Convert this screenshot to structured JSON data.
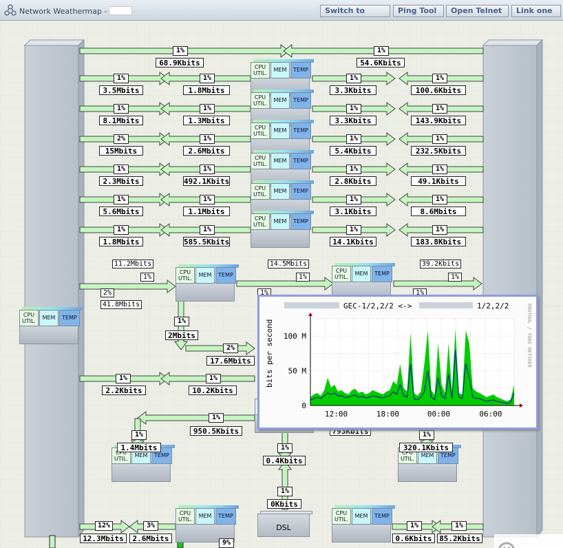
{
  "window": {
    "title": "Network Weathermap -",
    "buttons": [
      {
        "label": "Switch to",
        "x": 465,
        "w": 102
      },
      {
        "label": "Ping Tool",
        "x": 571,
        "w": 74
      },
      {
        "label": "Open Telnet",
        "x": 648,
        "w": 91
      },
      {
        "label": "Link one",
        "x": 743,
        "w": 72
      }
    ]
  },
  "device_labels": {
    "cpu": "CPU UTIL.",
    "cpu_short": "CPU",
    "mem": "MEM",
    "temp": "TEMP"
  },
  "dsl_label": "DSL",
  "link_rows": [
    {
      "lp": "1%",
      "lv": "68.9Kbits",
      "rp": "1%",
      "rv": "54.6Kbits"
    },
    {
      "p1": "1%",
      "v1": "3.5Mbits",
      "p2": "1%",
      "v2": "1.8Mbits",
      "p3": "1%",
      "v3": "3.3Kbits",
      "p4": "1%",
      "v4": "100.6Kbits"
    },
    {
      "p1": "1%",
      "v1": "8.1Mbits",
      "p2": "1%",
      "v2": "1.3Mbits",
      "p3": "1%",
      "v3": "3.3Kbits",
      "p4": "1%",
      "v4": "143.9Kbits"
    },
    {
      "p1": "2%",
      "v1": "15Mbits",
      "p2": "1%",
      "v2": "2.6Mbits",
      "p3": "1%",
      "v3": "5.4Kbits",
      "p4": "1%",
      "v4": "232.5Kbits"
    },
    {
      "p1": "1%",
      "v1": "2.3Mbits",
      "p2": "1%",
      "v2": "492.1Kbits",
      "p3": "1%",
      "v3": "2.8Kbits",
      "p4": "1%",
      "v4": "49.1Kbits"
    },
    {
      "p1": "1%",
      "v1": "5.6Mbits",
      "p2": "1%",
      "v2": "1.1Mbits",
      "p3": "1%",
      "v3": "3.1Kbits",
      "p4": "1%",
      "v4": "8.6Mbits"
    },
    {
      "p1": "1%",
      "v1": "1.8Mbits",
      "p2": "1%",
      "v2": "585.5Kbits",
      "p3": "1%",
      "v3": "14.1Kbits",
      "p4": "1%",
      "v4": "183.8Kbits"
    }
  ],
  "mid_links": {
    "a_val": "11.2Mbits",
    "a_pct": "1%",
    "b_pct": "2%",
    "b_val": "41.8Mbits",
    "c_val": "14.5Mbits",
    "c_pct": "1%",
    "d_val": "39.2Kbits",
    "d_pct": "1%",
    "e_pct": "1%",
    "f_pct": "1%",
    "down_pct": "1%",
    "down_val": "2Mbits",
    "right_pct": "2%",
    "right_val": "17.6Mbits",
    "row_p1": "1%",
    "row_v1": "2.2Kbits",
    "row_p2": "1%",
    "row_v2": "10.2Kbits",
    "lower_p1": "1%",
    "lower_v1": "950.5Kbits",
    "lower_p2": "1%",
    "lower_v2": "793Kbits",
    "left_pct": "1%",
    "left_val": "1.4Mbits",
    "right2_pct": "1%",
    "right2_val": "320.1Kbits",
    "dsl_pct_top": "1%",
    "dsl_val_top": "0.4Kbits",
    "dsl_pct_bot": "1%",
    "dsl_val_bot": "0Kbits",
    "bot_p1": "12%",
    "bot_v1": "12.3Mbits",
    "bot_p2": "3%",
    "bot_v2": "2.6Mbits",
    "bot_p3": "9%",
    "bot_p4": "1%",
    "bot_v4": "0.6Kbits",
    "bot_p5": "1%",
    "bot_v5": "85.2Kbits"
  },
  "popup": {
    "title_mid": "GEC-1/2,2/2 <->",
    "title_right": "1/2,2/2",
    "ylabel": "bits per second",
    "side_text": "RRDTOOL / TOBI OETIKER",
    "yticks": [
      "100 M",
      "50 M",
      "0"
    ],
    "xticks": [
      "12:00",
      "18:00",
      "00:00",
      "06:00"
    ],
    "colors": {
      "in": "#00cc00",
      "out": "#002a97"
    }
  },
  "chart_data": {
    "type": "area",
    "title": "GEC-1/2,2/2 <-> 1/2,2/2",
    "ylabel": "bits per second",
    "xlabel": "",
    "xticks": [
      "12:00",
      "18:00",
      "00:00",
      "06:00"
    ],
    "ylim": [
      0,
      125
    ],
    "yunit": "M",
    "series": [
      {
        "values": [
          12,
          16,
          18,
          14,
          22,
          40,
          26,
          30,
          20,
          22,
          18,
          16,
          22,
          24,
          18,
          20,
          16,
          18,
          22,
          20,
          18,
          16,
          20,
          22,
          35,
          30,
          60,
          25,
          20,
          105,
          18,
          14,
          20,
          60,
          108,
          22,
          15,
          90,
          30,
          18,
          90,
          20,
          110,
          18,
          16,
          108,
          90,
          25,
          20,
          18,
          15,
          12,
          14,
          16,
          12,
          10,
          8,
          6,
          9,
          30
        ]
      },
      {
        "values": [
          8,
          10,
          12,
          10,
          14,
          18,
          16,
          18,
          14,
          14,
          12,
          12,
          14,
          15,
          12,
          13,
          11,
          12,
          14,
          13,
          12,
          11,
          13,
          14,
          20,
          16,
          30,
          14,
          12,
          60,
          10,
          8,
          12,
          20,
          50,
          12,
          8,
          40,
          14,
          10,
          45,
          10,
          80,
          12,
          10,
          60,
          40,
          12,
          10,
          10,
          8,
          6,
          7,
          8,
          6,
          5,
          4,
          3,
          5,
          18
        ]
      }
    ]
  }
}
